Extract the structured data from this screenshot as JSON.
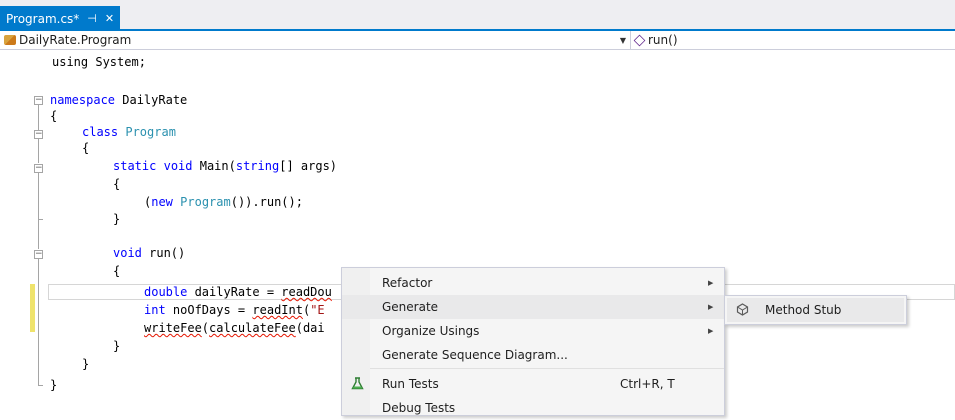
{
  "tab": {
    "title": "Program.cs*",
    "pin": "⊣",
    "close": "✕"
  },
  "navbar": {
    "class_path": "DailyRate.Program",
    "member": "run()"
  },
  "code": {
    "l1": "using System;",
    "l2a": "namespace",
    "l2b": " DailyRate",
    "l3": "{",
    "l4a": "class",
    "l4b": "Program",
    "l5": "{",
    "l6a": "static",
    "l6b": "void",
    "l6c": " Main(",
    "l6d": "string",
    "l6e": "[] args)",
    "l7": "{",
    "l8a": "(",
    "l8b": "new",
    "l8c": "Program",
    "l8d": "()).run();",
    "l9": "}",
    "l10a": "void",
    "l10b": " run()",
    "l11": "{",
    "l12a": "double",
    "l12b": " dailyRate = ",
    "l12c": "readDou",
    "l13a": "int",
    "l13b": " noOfDays = ",
    "l13c": "readInt",
    "l13d": "(",
    "l13e": "\"E",
    "l14a": "writeFee",
    "l14b": "(",
    "l14c": "calculateFee",
    "l14d": "(dai",
    "l15": "}",
    "l16": "}",
    "l17": "}"
  },
  "context_menu": {
    "refactor": "Refactor",
    "generate": "Generate",
    "organize_usings": "Organize Usings",
    "generate_sequence": "Generate Sequence Diagram...",
    "run_tests": "Run Tests",
    "run_tests_shortcut": "Ctrl+R, T",
    "debug_tests": "Debug Tests",
    "arrow": "▶"
  },
  "submenu": {
    "method_stub": "Method Stub"
  },
  "icons": {
    "class": "class-icon",
    "method": "method-icon",
    "tests": "flask-icon",
    "stub": "method-stub-icon"
  }
}
